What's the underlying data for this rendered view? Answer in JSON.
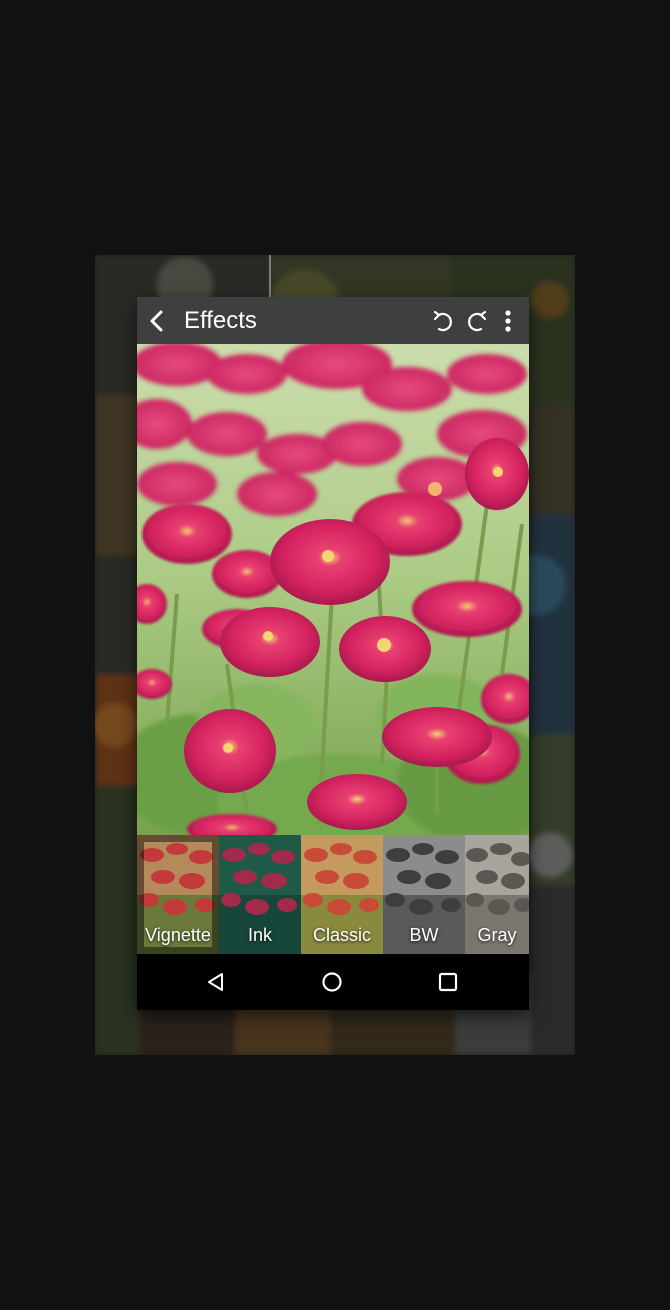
{
  "toolbar": {
    "title": "Effects",
    "back_icon": "chevron-left-icon",
    "undo_icon": "undo-icon",
    "redo_icon": "redo-icon",
    "overflow_icon": "more-vertical-icon"
  },
  "photo": {
    "subject": "pink daisy flowers",
    "colors": {
      "flower": "#d6175a",
      "leaf": "#6fa148",
      "sky": "#b9d79a"
    }
  },
  "effects": [
    {
      "label": "Vignette",
      "tint": "#c2664e"
    },
    {
      "label": "Ink",
      "tint": "#2b6f58"
    },
    {
      "label": "Classic",
      "tint": "#b97642"
    },
    {
      "label": "BW",
      "tint": "#777777"
    },
    {
      "label": "Gray",
      "tint": "#8f8d88"
    }
  ],
  "navbar": {
    "back_icon": "triangle-back-icon",
    "home_icon": "circle-home-icon",
    "recents_icon": "square-recents-icon"
  },
  "colors": {
    "background": "#101111",
    "toolbar": "#3e3f3f",
    "navbar": "#000000"
  }
}
